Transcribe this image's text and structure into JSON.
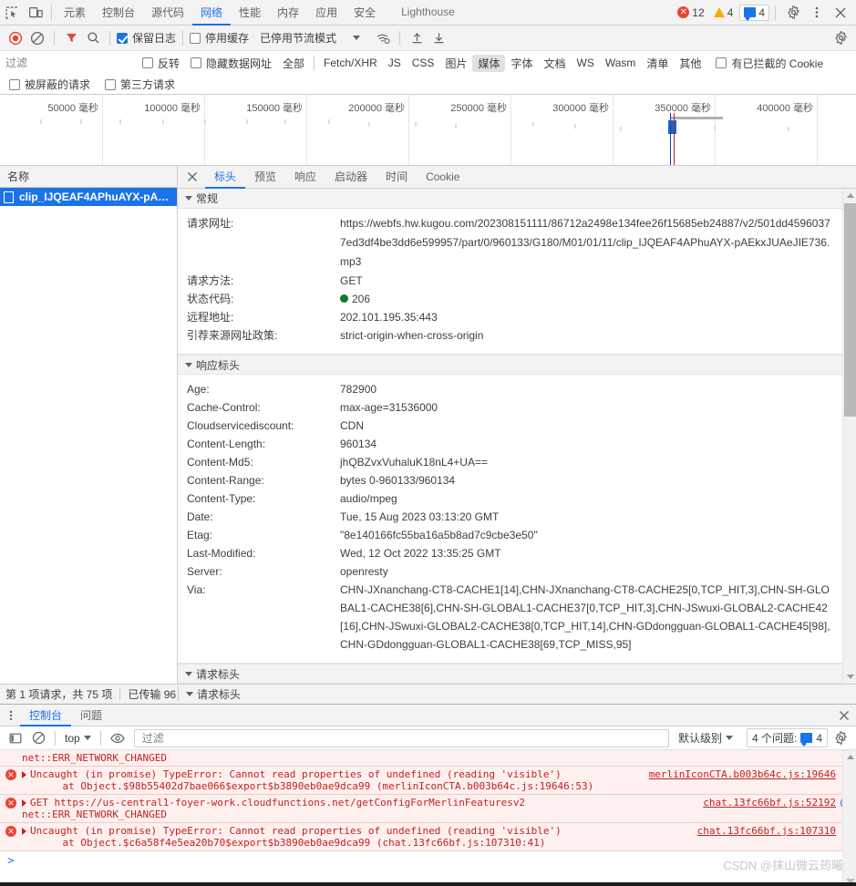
{
  "window": {
    "main_tabs": [
      {
        "label": "元素",
        "active": false
      },
      {
        "label": "控制台",
        "active": false
      },
      {
        "label": "源代码",
        "active": false
      },
      {
        "label": "网络",
        "active": true
      },
      {
        "label": "性能",
        "active": false
      },
      {
        "label": "内存",
        "active": false
      },
      {
        "label": "应用",
        "active": false
      },
      {
        "label": "安全",
        "active": false
      },
      {
        "label": "Lighthouse",
        "active": false
      }
    ],
    "counters": {
      "errors": "12",
      "warnings": "4",
      "issues": "4"
    },
    "icons": {
      "inspect": "inspect-element-icon",
      "device": "device-toolbar-icon",
      "settings": "gear-icon",
      "more": "more-vertical-icon",
      "close": "close-icon"
    }
  },
  "network_toolbar": {
    "record_label": "record-button",
    "clear_label": "clear-button",
    "filter_toggle_label": "filter-funnel-icon",
    "search_label": "search-icon",
    "preserve_log": {
      "label": "保留日志",
      "checked": true
    },
    "disable_cache": {
      "label": "停用缓存",
      "checked": false
    },
    "throttling": "已停用节流模式",
    "wifi_label": "network-conditions-icon",
    "import_label": "import-har-icon",
    "export_label": "export-har-icon",
    "settings_label": "network-settings-gear-icon"
  },
  "filter_bar": {
    "filter_placeholder": "过滤",
    "filter_value": "",
    "invert": {
      "label": "反转",
      "checked": false
    },
    "hide_data_urls": {
      "label": "隐藏数据网址",
      "checked": false
    },
    "types": [
      {
        "label": "全部",
        "selected": false
      },
      {
        "label": "Fetch/XHR",
        "selected": false
      },
      {
        "label": "JS",
        "selected": false
      },
      {
        "label": "CSS",
        "selected": false
      },
      {
        "label": "图片",
        "selected": false
      },
      {
        "label": "媒体",
        "selected": true
      },
      {
        "label": "字体",
        "selected": false
      },
      {
        "label": "文档",
        "selected": false
      },
      {
        "label": "WS",
        "selected": false
      },
      {
        "label": "Wasm",
        "selected": false
      },
      {
        "label": "清单",
        "selected": false
      },
      {
        "label": "其他",
        "selected": false
      }
    ],
    "blocked_cookies": {
      "label": "有已拦截的 Cookie",
      "checked": false
    },
    "blocked_requests": {
      "label": "被屏蔽的请求",
      "checked": false
    },
    "third_party": {
      "label": "第三方请求",
      "checked": false
    }
  },
  "chart_data": {
    "type": "area",
    "title": "",
    "xlabel": "",
    "ylabel": "",
    "unit": "毫秒",
    "tick_labels": [
      "50000 毫秒",
      "100000 毫秒",
      "150000 毫秒",
      "200000 毫秒",
      "250000 毫秒",
      "300000 毫秒",
      "350000 毫秒",
      "400000 毫秒"
    ],
    "tick_values": [
      50000,
      100000,
      150000,
      200000,
      250000,
      300000,
      350000,
      400000
    ],
    "xlim": [
      0,
      430000
    ],
    "grid": true,
    "selection_marker_ms": 350000,
    "events": [
      {
        "name": "dom-content-loaded",
        "ms": 349000,
        "color": "#1a3fb5"
      },
      {
        "name": "load",
        "ms": 351000,
        "color": "#b3261e"
      }
    ]
  },
  "request_list": {
    "column_header": "名称",
    "rows": [
      {
        "name": "clip_IJQEAF4APhuAYX-pAEkxJ...",
        "selected": true
      }
    ]
  },
  "details": {
    "tabs": [
      {
        "label": "标头",
        "active": true
      },
      {
        "label": "预览",
        "active": false
      },
      {
        "label": "响应",
        "active": false
      },
      {
        "label": "启动器",
        "active": false
      },
      {
        "label": "时间",
        "active": false
      },
      {
        "label": "Cookie",
        "active": false
      }
    ],
    "sections": [
      {
        "title": "常规",
        "rows": [
          {
            "key": "请求网址:",
            "value": "https://webfs.hw.kugou.com/202308151111/86712a2498e134fee26f15685eb24887/v2/501dd45960377ed3df4be3dd6e599957/part/0/960133/G180/M01/01/11/clip_IJQEAF4APhuAYX-pAEkxJUAeJIE736.mp3"
          },
          {
            "key": "请求方法:",
            "value": "GET"
          },
          {
            "key": "状态代码:",
            "value": "206",
            "status_dot": "#0d7a28"
          },
          {
            "key": "远程地址:",
            "value": "202.101.195.35:443"
          },
          {
            "key": "引荐来源网址政策:",
            "value": "strict-origin-when-cross-origin"
          }
        ]
      },
      {
        "title": "响应标头",
        "rows": [
          {
            "key": "Age:",
            "value": "782900"
          },
          {
            "key": "Cache-Control:",
            "value": "max-age=31536000"
          },
          {
            "key": "Cloudservicediscount:",
            "value": "CDN"
          },
          {
            "key": "Content-Length:",
            "value": "960134"
          },
          {
            "key": "Content-Md5:",
            "value": "jhQBZvxVuhaluK18nL4+UA=="
          },
          {
            "key": "Content-Range:",
            "value": "bytes 0-960133/960134"
          },
          {
            "key": "Content-Type:",
            "value": "audio/mpeg"
          },
          {
            "key": "Date:",
            "value": "Tue, 15 Aug 2023 03:13:20 GMT"
          },
          {
            "key": "Etag:",
            "value": "\"8e140166fc55ba16a5b8ad7c9cbe3e50\""
          },
          {
            "key": "Last-Modified:",
            "value": "Wed, 12 Oct 2022 13:35:25 GMT"
          },
          {
            "key": "Server:",
            "value": "openresty"
          },
          {
            "key": "Via:",
            "value": "CHN-JXnanchang-CT8-CACHE1[14],CHN-JXnanchang-CT8-CACHE25[0,TCP_HIT,3],CHN-SH-GLOBAL1-CACHE38[6],CHN-SH-GLOBAL1-CACHE37[0,TCP_HIT,3],CHN-JSwuxi-GLOBAL2-CACHE42[16],CHN-JSwuxi-GLOBAL2-CACHE38[0,TCP_HIT,14],CHN-GDdongguan-GLOBAL1-CACHE45[98],CHN-GDdongguan-GLOBAL1-CACHE38[69,TCP_MISS,95]"
          }
        ]
      },
      {
        "title": "请求标头",
        "rows": []
      }
    ]
  },
  "statusbar": {
    "requests": "第 1 项请求，共 75 项",
    "transferred": "已传输 96",
    "right_section": "请求标头"
  },
  "drawer": {
    "tabs": [
      {
        "label": "控制台",
        "active": true
      },
      {
        "label": "问题",
        "active": false
      }
    ],
    "toolbar": {
      "sidebar_toggle": "console-sidebar-icon",
      "clear": "clear-console-icon",
      "context": "top",
      "eye": "live-expression-icon",
      "filter_placeholder": "过滤",
      "filter_value": "",
      "level": "默认级别",
      "issues": "4 个问题:",
      "issues_count": "4",
      "settings": "console-settings-gear-icon"
    },
    "messages": [
      {
        "kind": "net-only",
        "text": "net::ERR_NETWORK_CHANGED"
      },
      {
        "kind": "error",
        "text": "Uncaught (in promise) TypeError: Cannot read properties of undefined (reading 'visible')",
        "stack": "    at Object.$98b55402d7bae066$export$b3890eb0ae9dca99 (",
        "stack_link": "merlinIconCTA.b003b64c.js:19646:53",
        "stack_tail": ")",
        "source": "merlinIconCTA.b003b64c.js:19646"
      },
      {
        "kind": "request-error",
        "method": "GET",
        "url": "https://us-central1-foyer-work.cloudfunctions.net/getConfigForMerlinFeaturesv2",
        "net": "net::ERR_NETWORK_CHANGED",
        "source": "chat.13fc66bf.js:52192",
        "has_globe": true
      },
      {
        "kind": "error",
        "text": "Uncaught (in promise) TypeError: Cannot read properties of undefined (reading 'visible')",
        "stack": "    at Object.$c6a58f4e5ea20b70$export$b3890eb0ae9dca99 (",
        "stack_link": "chat.13fc66bf.js:107310:41",
        "stack_tail": ")",
        "source": "chat.13fc66bf.js:107310"
      }
    ],
    "prompt": ">"
  },
  "watermark": "CSDN @抹山微云筠曦"
}
